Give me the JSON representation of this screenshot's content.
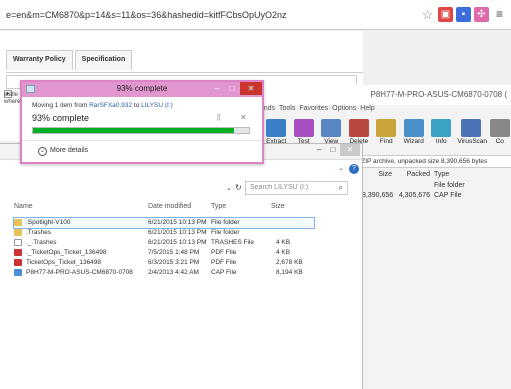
{
  "browser": {
    "url": "e=en&m=CM6870&p=14&s=11&os=36&hashedid=kitfFCbsOpUyO2nz",
    "icons": [
      "star-icon",
      "extension-red-icon",
      "extension-blue-icon",
      "extension-pink-icon",
      "menu-icon"
    ]
  },
  "webpage": {
    "tabs": [
      "Warranty Policy",
      "Specification"
    ],
    "side_fragments": [
      "stalle",
      "where"
    ]
  },
  "winrar": {
    "title": "P8H77-M-PRO-ASUS-CM6870-0708 (",
    "menu": [
      "mands",
      "Tools",
      "Favorites",
      "Options",
      "Help"
    ],
    "toolbar": [
      {
        "label": "Extract To",
        "color": "#3a7fc8"
      },
      {
        "label": "Test",
        "color": "#a84fc2"
      },
      {
        "label": "View",
        "color": "#5a86c4"
      },
      {
        "label": "Delete",
        "color": "#b8473e"
      },
      {
        "label": "Find",
        "color": "#c9a438"
      },
      {
        "label": "Wizard",
        "color": "#4a90c9"
      },
      {
        "label": "Info",
        "color": "#3aa3c4"
      },
      {
        "label": "VirusScan",
        "color": "#4a73b8"
      },
      {
        "label": "Co",
        "color": "#888888"
      }
    ],
    "pathbar": "8 (1).zip - ZIP archive, unpacked size 8,390,656 bytes",
    "columns": {
      "size": "Size",
      "packed": "Packed",
      "type": "Type"
    },
    "rows": [
      {
        "size": "",
        "packed": "",
        "type": "File folder"
      },
      {
        "size": "8,390,656",
        "packed": "4,305,676",
        "type": "CAP File"
      }
    ]
  },
  "explorer": {
    "search_placeholder": "Search LILYSU (I:)",
    "columns": {
      "name": "Name",
      "date": "Date modified",
      "type": "Type",
      "size": "Size"
    },
    "files": [
      {
        "icon": "folder",
        "name": ".Spotlight-V100",
        "date": "6/21/2015 10:13 PM",
        "type": "File folder",
        "size": ""
      },
      {
        "icon": "folder",
        "name": ".Trashes",
        "date": "6/21/2015 10:13 PM",
        "type": "File folder",
        "size": ""
      },
      {
        "icon": "file",
        "name": "._.Trashes",
        "date": "6/21/2015 10:13 PM",
        "type": "TRASHES File",
        "size": "4 KB"
      },
      {
        "icon": "pdf",
        "name": "._TicketOps_Ticket_136498",
        "date": "7/5/2015 1:48 PM",
        "type": "PDF File",
        "size": "4 KB"
      },
      {
        "icon": "pdf",
        "name": "TicketOps_Ticket_136498",
        "date": "6/3/2015 3:21 PM",
        "type": "PDF File",
        "size": "2,678 KB"
      },
      {
        "icon": "cap",
        "name": "P8H77-M-PRO-ASUS-CM6870-0708",
        "date": "2/4/2013 4:42 AM",
        "type": "CAP File",
        "size": "8,194 KB"
      }
    ]
  },
  "dialog": {
    "title": "93% complete",
    "moving_prefix": "Moving 1 item from",
    "source": "RarSFXa0.932",
    "moving_to": "to",
    "destination": "LILYSU (I:)",
    "percent_text": "93% complete",
    "progress": 0.93,
    "more_details": "More details",
    "progress_color": "#06b025"
  }
}
